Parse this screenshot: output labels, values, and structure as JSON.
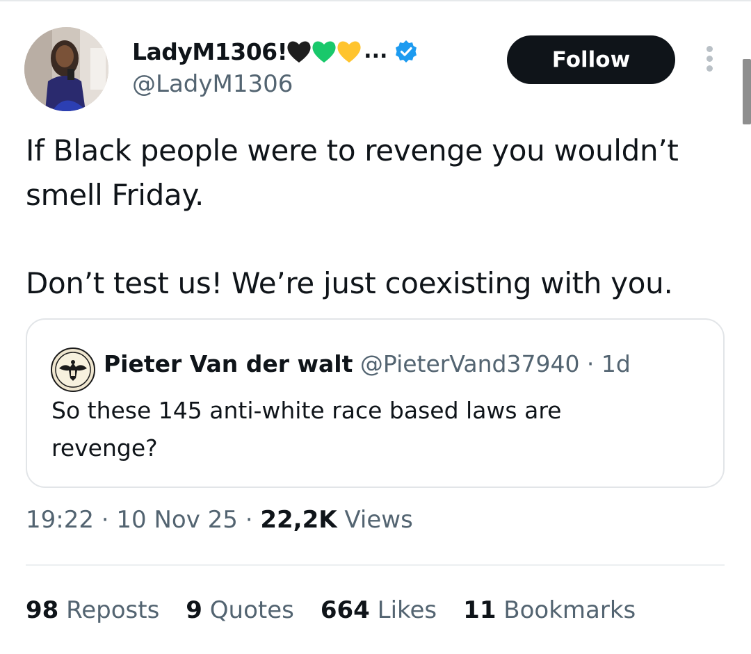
{
  "author": {
    "display_name": "LadyM1306!",
    "emojis": [
      "black-heart-icon",
      "green-heart-icon",
      "yellow-heart-icon"
    ],
    "truncation": "...",
    "handle": "@LadyM1306",
    "verified": true
  },
  "follow_label": "Follow",
  "tweet": {
    "lines": [
      "If Black people were to revenge you wouldn’t",
      "smell Friday.",
      "Don’t test us! We’re just coexisting with you."
    ]
  },
  "quoted": {
    "name": "Pieter Van der walt",
    "handle": "@PieterVand37940",
    "separator": " · ",
    "age": "1d",
    "text_lines": [
      "So these 145 anti-white race based laws are",
      "revenge?"
    ]
  },
  "meta": {
    "time": "19:22",
    "sep1": " · ",
    "date": "10 Nov 25",
    "sep2": " · ",
    "views_count": "22,2K",
    "views_label": " Views"
  },
  "stats": [
    {
      "count": "98",
      "label": " Reposts"
    },
    {
      "count": "9",
      "label": " Quotes"
    },
    {
      "count": "664",
      "label": " Likes"
    },
    {
      "count": "11",
      "label": " Bookmarks"
    }
  ],
  "colors": {
    "verified_blue": "#1d9bf0",
    "text_primary": "#0f1419",
    "text_secondary": "#536471",
    "follow_bg": "#0f1419"
  }
}
